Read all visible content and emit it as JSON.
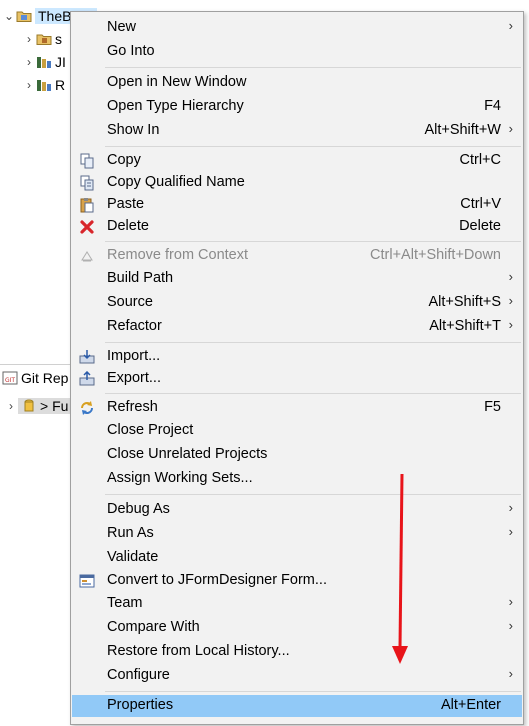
{
  "tree": {
    "project": "TheBook",
    "children": [
      {
        "label": "s"
      },
      {
        "label": "JI"
      },
      {
        "label": "R"
      }
    ]
  },
  "git_panel": {
    "title": "Git Rep",
    "repo_label": "> Fu"
  },
  "menu": {
    "items": [
      {
        "label": "New",
        "shortcut": "",
        "submenu": true
      },
      {
        "label": "Go Into",
        "shortcut": "",
        "submenu": false
      },
      {
        "label": "Open in New Window",
        "shortcut": "",
        "submenu": false
      },
      {
        "label": "Open Type Hierarchy",
        "shortcut": "F4",
        "submenu": false
      },
      {
        "label": "Show In",
        "shortcut": "Alt+Shift+W",
        "submenu": true
      },
      {
        "label": "Copy",
        "shortcut": "Ctrl+C",
        "submenu": false,
        "icon": "copy-icon"
      },
      {
        "label": "Copy Qualified Name",
        "shortcut": "",
        "submenu": false,
        "icon": "copy-qualified-icon"
      },
      {
        "label": "Paste",
        "shortcut": "Ctrl+V",
        "submenu": false,
        "icon": "paste-icon"
      },
      {
        "label": "Delete",
        "shortcut": "Delete",
        "submenu": false,
        "icon": "delete-icon"
      },
      {
        "label": "Remove from Context",
        "shortcut": "Ctrl+Alt+Shift+Down",
        "submenu": false,
        "disabled": true,
        "icon": "remove-context-icon"
      },
      {
        "label": "Build Path",
        "shortcut": "",
        "submenu": true
      },
      {
        "label": "Source",
        "shortcut": "Alt+Shift+S",
        "submenu": true
      },
      {
        "label": "Refactor",
        "shortcut": "Alt+Shift+T",
        "submenu": true
      },
      {
        "label": "Import...",
        "shortcut": "",
        "submenu": false,
        "icon": "import-icon"
      },
      {
        "label": "Export...",
        "shortcut": "",
        "submenu": false,
        "icon": "export-icon"
      },
      {
        "label": "Refresh",
        "shortcut": "F5",
        "submenu": false,
        "icon": "refresh-icon"
      },
      {
        "label": "Close Project",
        "shortcut": "",
        "submenu": false
      },
      {
        "label": "Close Unrelated Projects",
        "shortcut": "",
        "submenu": false
      },
      {
        "label": "Assign Working Sets...",
        "shortcut": "",
        "submenu": false
      },
      {
        "label": "Debug As",
        "shortcut": "",
        "submenu": true
      },
      {
        "label": "Run As",
        "shortcut": "",
        "submenu": true
      },
      {
        "label": "Validate",
        "shortcut": "",
        "submenu": false
      },
      {
        "label": "Convert to JFormDesigner Form...",
        "shortcut": "",
        "submenu": false,
        "icon": "jformdesigner-icon"
      },
      {
        "label": "Team",
        "shortcut": "",
        "submenu": true
      },
      {
        "label": "Compare With",
        "shortcut": "",
        "submenu": true
      },
      {
        "label": "Restore from Local History...",
        "shortcut": "",
        "submenu": false
      },
      {
        "label": "Configure",
        "shortcut": "",
        "submenu": true
      },
      {
        "label": "Properties",
        "shortcut": "Alt+Enter",
        "submenu": false,
        "highlighted": true
      }
    ]
  },
  "colors": {
    "menu_bg": "#f2f2f2",
    "highlight": "#91c9f7",
    "annotation_arrow": "#e8141a"
  }
}
